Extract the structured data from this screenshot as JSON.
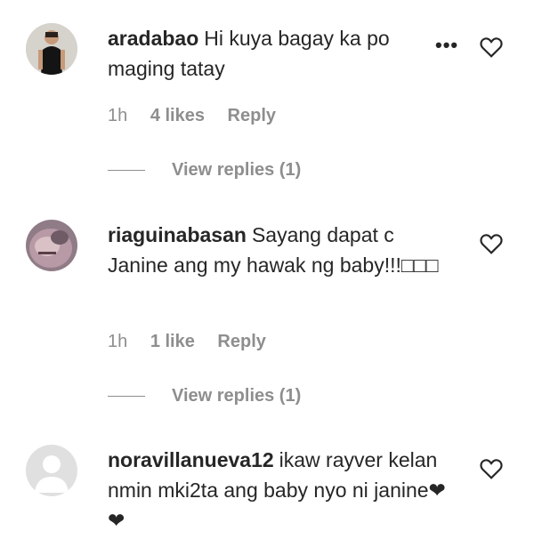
{
  "comments": [
    {
      "username": "aradabao",
      "text": "Hi kuya bagay ka po maging tatay",
      "time": "1h",
      "likes": "4 likes",
      "reply_label": "Reply",
      "view_replies": "View replies (1)",
      "more_icon": "more-horizontal-icon",
      "heart_icon": "heart-outline-icon"
    },
    {
      "username": "riaguinabasan",
      "text": "Sayang dapat c Janine ang my hawak ng baby!!!□□□",
      "time": "1h",
      "likes": "1 like",
      "reply_label": "Reply",
      "view_replies": "View replies (1)",
      "heart_icon": "heart-outline-icon"
    },
    {
      "username": "noravillanueva12",
      "text": "ikaw rayver kelan nmin mki2ta ang baby nyo ni janine❤❤",
      "heart_icon": "heart-outline-icon"
    }
  ],
  "colors": {
    "text": "#262626",
    "secondary": "#8e8e8e",
    "placeholder_avatar": "#e0e0e0"
  }
}
